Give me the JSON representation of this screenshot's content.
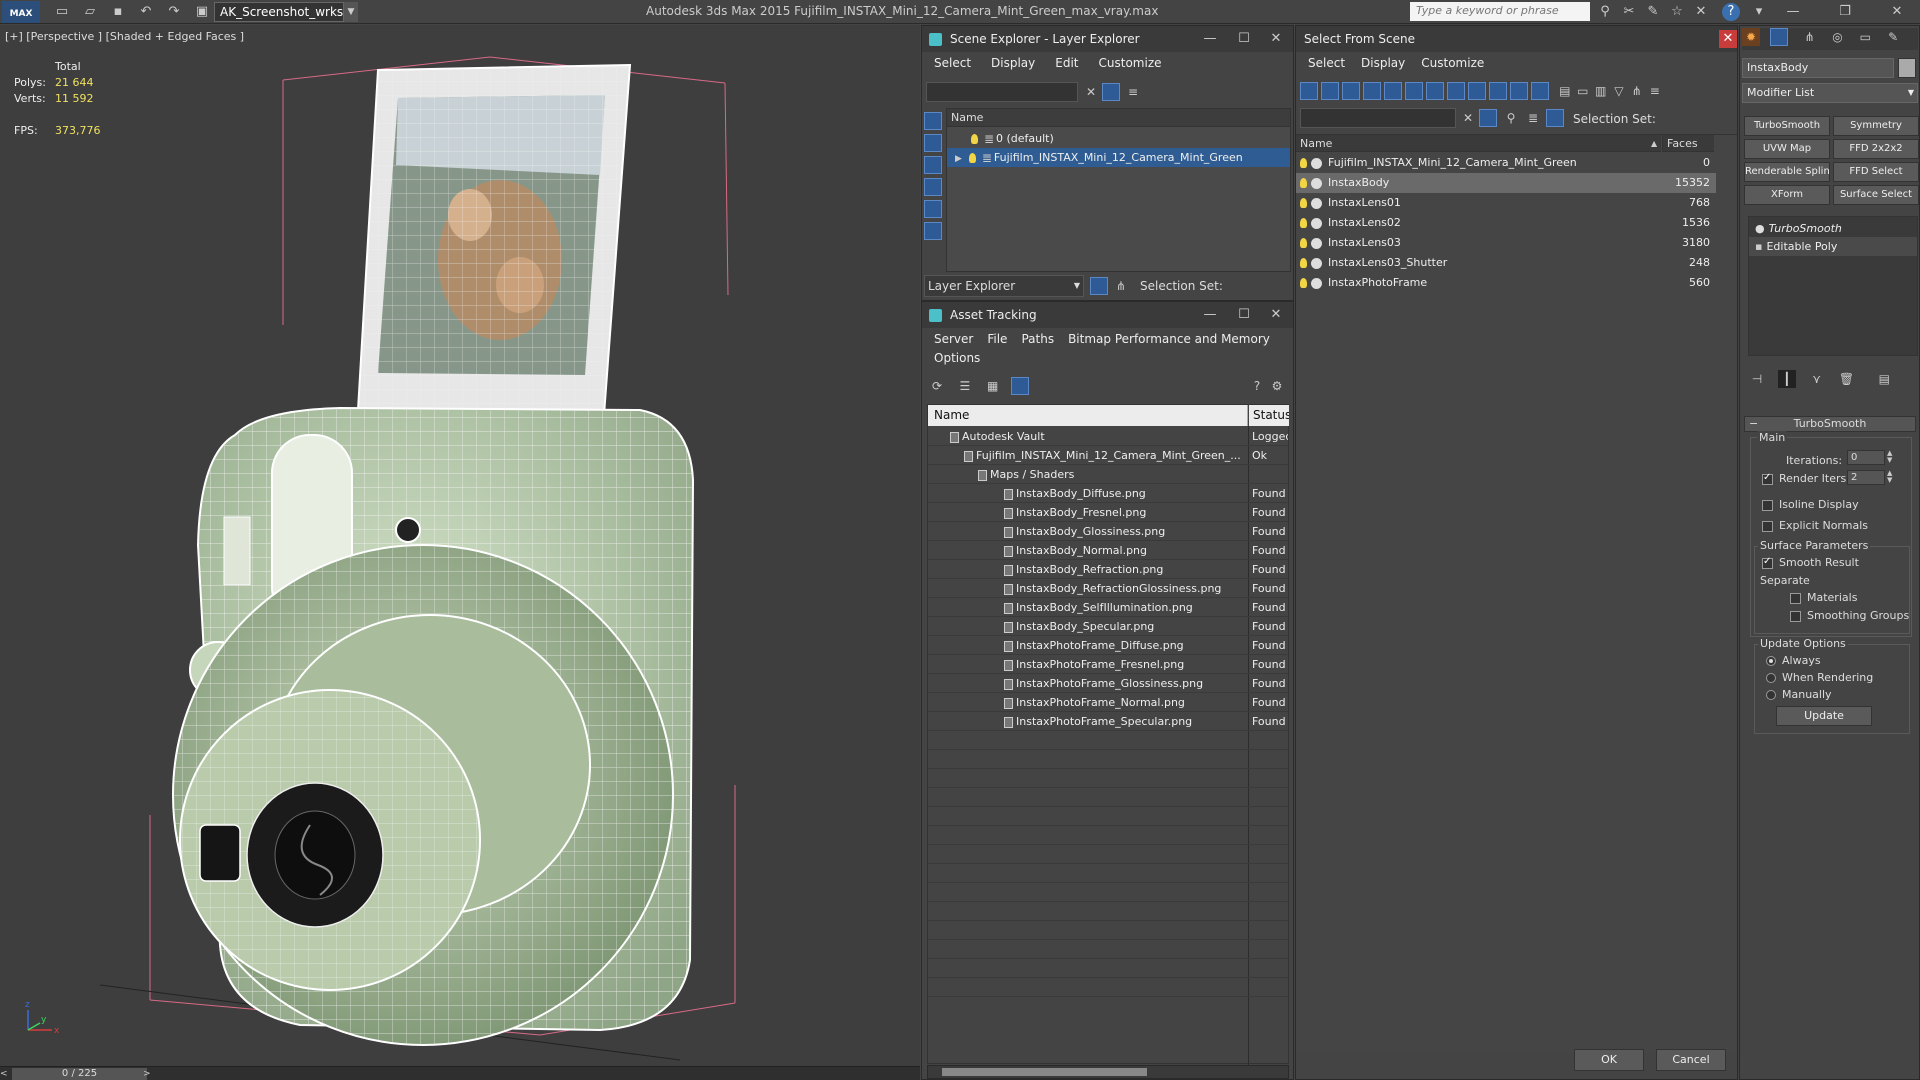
{
  "title_bar": {
    "app_logo": "MAX",
    "workspace": "AK_Screenshot_wrksp",
    "app_title": "Autodesk 3ds Max 2015 Fujifilm_INSTAX_Mini_12_Camera_Mint_Green_max_vray.max",
    "search_placeholder": "Type a keyword or phrase"
  },
  "viewport": {
    "label": "[+] [Perspective ] [Shaded + Edged Faces ]",
    "stats": {
      "total_label": "Total",
      "polys_label": "Polys:",
      "polys": "21 644",
      "verts_label": "Verts:",
      "verts": "11 592",
      "fps_label": "FPS:",
      "fps": "373,776"
    },
    "axis": {
      "x": "x",
      "y": "y",
      "z": "z"
    }
  },
  "timeline": {
    "frame": "0 / 225"
  },
  "scene_explorer": {
    "title": "Scene Explorer - Layer Explorer",
    "menu": [
      "Select",
      "Display",
      "Edit",
      "Customize"
    ],
    "col_name": "Name",
    "rows": [
      {
        "label": "0 (default)"
      },
      {
        "label": "Fujifilm_INSTAX_Mini_12_Camera_Mint_Green"
      }
    ],
    "footer_dropdown": "Layer Explorer",
    "selection_set_label": "Selection Set:"
  },
  "asset_tracking": {
    "title": "Asset Tracking",
    "menu": [
      "Server",
      "File",
      "Paths",
      "Bitmap Performance and Memory"
    ],
    "menu2": "Options",
    "col_name": "Name",
    "col_status": "Status",
    "rows": [
      {
        "name": "Autodesk Vault",
        "status": "Logged"
      },
      {
        "name": "Fujifilm_INSTAX_Mini_12_Camera_Mint_Green_...",
        "status": "Ok"
      },
      {
        "name": "Maps / Shaders",
        "status": ""
      },
      {
        "name": "InstaxBody_Diffuse.png",
        "status": "Found"
      },
      {
        "name": "InstaxBody_Fresnel.png",
        "status": "Found"
      },
      {
        "name": "InstaxBody_Glossiness.png",
        "status": "Found"
      },
      {
        "name": "InstaxBody_Normal.png",
        "status": "Found"
      },
      {
        "name": "InstaxBody_Refraction.png",
        "status": "Found"
      },
      {
        "name": "InstaxBody_RefractionGlossiness.png",
        "status": "Found"
      },
      {
        "name": "InstaxBody_SelfIllumination.png",
        "status": "Found"
      },
      {
        "name": "InstaxBody_Specular.png",
        "status": "Found"
      },
      {
        "name": "InstaxPhotoFrame_Diffuse.png",
        "status": "Found"
      },
      {
        "name": "InstaxPhotoFrame_Fresnel.png",
        "status": "Found"
      },
      {
        "name": "InstaxPhotoFrame_Glossiness.png",
        "status": "Found"
      },
      {
        "name": "InstaxPhotoFrame_Normal.png",
        "status": "Found"
      },
      {
        "name": "InstaxPhotoFrame_Specular.png",
        "status": "Found"
      }
    ]
  },
  "select_from_scene": {
    "title": "Select From Scene",
    "menu": [
      "Select",
      "Display",
      "Customize"
    ],
    "selection_set_label": "Selection Set:",
    "col_name": "Name",
    "col_faces": "Faces",
    "rows": [
      {
        "name": "Fujifilm_INSTAX_Mini_12_Camera_Mint_Green",
        "faces": "0"
      },
      {
        "name": "InstaxBody",
        "faces": "15352"
      },
      {
        "name": "InstaxLens01",
        "faces": "768"
      },
      {
        "name": "InstaxLens02",
        "faces": "1536"
      },
      {
        "name": "InstaxLens03",
        "faces": "3180"
      },
      {
        "name": "InstaxLens03_Shutter",
        "faces": "248"
      },
      {
        "name": "InstaxPhotoFrame",
        "faces": "560"
      }
    ],
    "ok": "OK",
    "cancel": "Cancel"
  },
  "command_panel": {
    "object_name": "InstaxBody",
    "modifier_list": "Modifier List",
    "mod_buttons": [
      "TurboSmooth",
      "Symmetry",
      "UVW Map",
      "FFD 2x2x2",
      "Renderable Spline",
      "FFD Select",
      "XForm",
      "Surface Select"
    ],
    "stack": [
      "TurboSmooth",
      "Editable Poly"
    ],
    "rollout_title": "TurboSmooth",
    "main_label": "Main",
    "iterations_label": "Iterations:",
    "iterations": "0",
    "render_iters_label": "Render Iters:",
    "render_iters": "2",
    "isoline": "Isoline Display",
    "explicit_normals": "Explicit Normals",
    "surface_params": "Surface Parameters",
    "smooth_result": "Smooth Result",
    "separate": "Separate",
    "materials": "Materials",
    "smoothing_groups": "Smoothing Groups",
    "update_options": "Update Options",
    "always": "Always",
    "when_rendering": "When Rendering",
    "manually": "Manually",
    "update": "Update"
  }
}
